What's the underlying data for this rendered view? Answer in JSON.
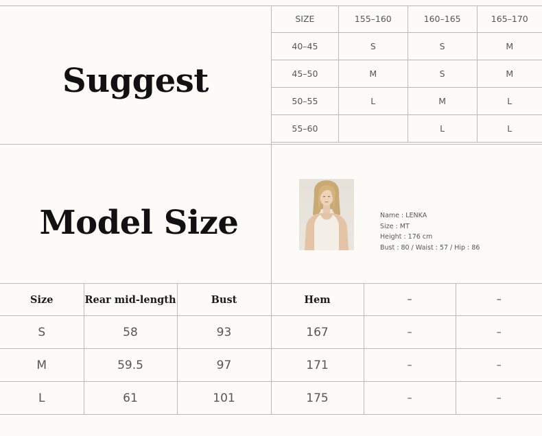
{
  "suggest": {
    "title": "Suggest",
    "header": [
      "SIZE",
      "155–160",
      "160–165",
      "165–170"
    ],
    "rows": [
      [
        "40–45",
        "S",
        "S",
        "M"
      ],
      [
        "45–50",
        "M",
        "S",
        "M"
      ],
      [
        "50–55",
        "L",
        "M",
        "L"
      ],
      [
        "55–60",
        "",
        "L",
        "L"
      ]
    ]
  },
  "model": {
    "title": "Model Size",
    "info": [
      "Name : LENKA",
      "Size : MT",
      "Height : 176 cm",
      "Bust : 80 / Waist : 57 / Hip : 86"
    ]
  },
  "size_chart": {
    "header": [
      "Size",
      "Rear mid-length",
      "Bust",
      "Hem",
      "–",
      "–"
    ],
    "rows": [
      [
        "S",
        "58",
        "93",
        "167",
        "–",
        "–"
      ],
      [
        "M",
        "59.5",
        "97",
        "171",
        "–",
        "–"
      ],
      [
        "L",
        "61",
        "101",
        "175",
        "–",
        "–"
      ]
    ]
  }
}
